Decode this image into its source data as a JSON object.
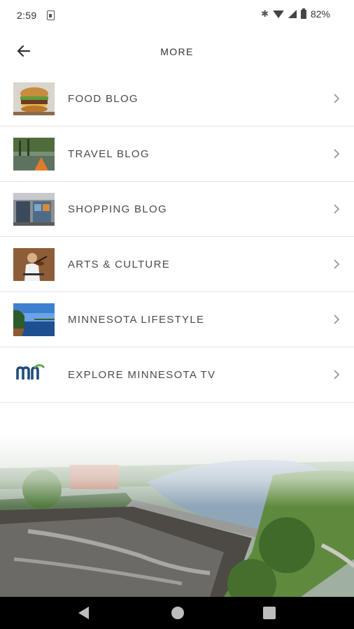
{
  "status_bar": {
    "time": "2:59",
    "battery": "82%"
  },
  "app_bar": {
    "title": "MORE",
    "back_icon": "arrow-left-icon"
  },
  "menu": {
    "items": [
      {
        "label": "FOOD BLOG",
        "thumb": "burger-photo"
      },
      {
        "label": "TRAVEL BLOG",
        "thumb": "kayak-lake-photo"
      },
      {
        "label": "SHOPPING BLOG",
        "thumb": "storefront-photo"
      },
      {
        "label": "ARTS & CULTURE",
        "thumb": "violinist-photo"
      },
      {
        "label": "MINNESOTA LIFESTYLE",
        "thumb": "lake-shore-photo"
      },
      {
        "label": "EXPLORE MINNESOTA TV",
        "thumb": "explore-minnesota-logo"
      }
    ],
    "logo_text": "EXPLORE MINNESOTA",
    "chevron_icon": "chevron-right-icon"
  },
  "footer_image": "river-dam-aerial-photo",
  "colors": {
    "accent": "#1f4e79",
    "logo_green": "#6aa84f",
    "text": "#4a4a4a",
    "divider": "#e4e4e4"
  }
}
